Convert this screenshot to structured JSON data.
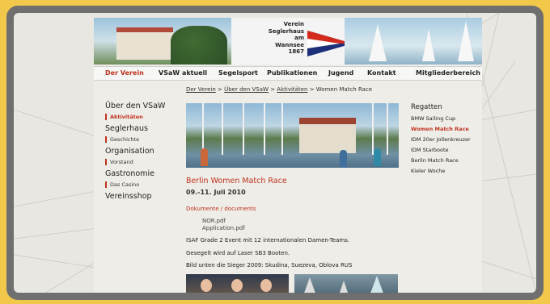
{
  "header": {
    "logo_lines": [
      "Verein",
      "Seglerhaus",
      "am",
      "Wannsee",
      "1867"
    ]
  },
  "nav": {
    "items": [
      "Der Verein",
      "VSaW aktuell",
      "Segelsport",
      "Publikationen",
      "Jugend",
      "Kontakt",
      "Mitgliederbereich"
    ],
    "active_index": 0
  },
  "breadcrumb": {
    "items": [
      "Der Verein",
      "Über den VSaW",
      "Aktivitäten"
    ],
    "separator": ">",
    "current": "Women Match Race"
  },
  "left_nav": [
    {
      "label": "Über den VSaW",
      "level": 1
    },
    {
      "label": "Aktivitäten",
      "level": 2,
      "active": true
    },
    {
      "label": "Seglerhaus",
      "level": 1
    },
    {
      "label": "Geschichte",
      "level": 2
    },
    {
      "label": "Organisation",
      "level": 1
    },
    {
      "label": "Vorstand",
      "level": 2
    },
    {
      "label": "Gastronomie",
      "level": 1
    },
    {
      "label": "Das Casino",
      "level": 2
    },
    {
      "label": "Vereinsshop",
      "level": 1
    }
  ],
  "article": {
    "title": "Berlin Women Match Race",
    "date": "09.-11. Juli 2010",
    "docs_label": "Dokumente / documents",
    "files": [
      "NOR.pdf",
      "Application.pdf"
    ],
    "paragraphs": [
      "ISAF Grade 2 Event mit 12 internationalen Damen-Teams.",
      "Gesegelt wird auf Laser SB3 Booten.",
      "Bild unten die Sieger 2009:  Skudina, Suezeva, Oblova  RUS"
    ]
  },
  "right_nav": {
    "heading": "Regatten",
    "items": [
      "BMW Sailing Cup",
      "Women Match Race",
      "IDM 20er Jollenkreuzer",
      "IDM Starboote",
      "Berlin Match Race",
      "Kieler Woche"
    ],
    "active_index": 1
  },
  "colors": {
    "accent": "#c0321d",
    "frame": "#6f6f6f",
    "backdrop": "#f2c84b"
  }
}
